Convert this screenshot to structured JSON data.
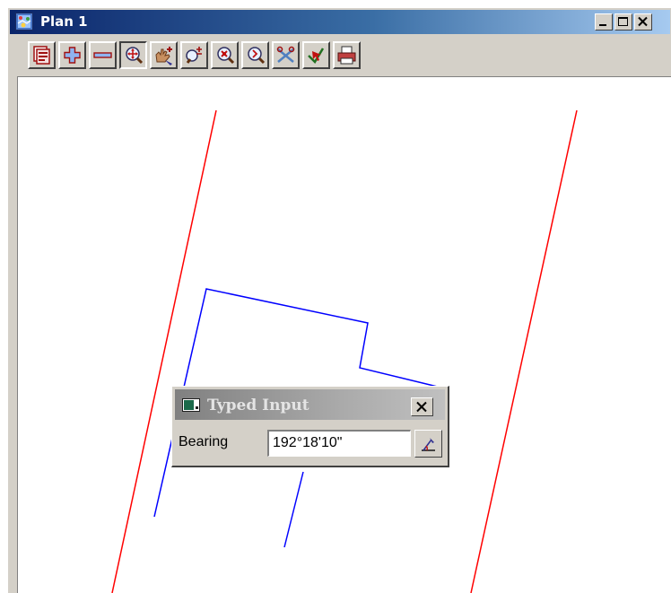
{
  "window": {
    "title": "Plan 1",
    "title_icon": "plan-view-icon",
    "caption_buttons": [
      "minimize-icon",
      "maximize-icon",
      "close-icon"
    ]
  },
  "toolbar": {
    "buttons": [
      {
        "name": "plot-views-button",
        "icon": "views-icon"
      },
      {
        "name": "zoom-in-button",
        "icon": "plus-icon"
      },
      {
        "name": "zoom-out-button",
        "icon": "minus-icon"
      },
      {
        "name": "pan-button",
        "icon": "pan-zoom-icon",
        "pressed": true
      },
      {
        "name": "add-element-button",
        "icon": "hand-plus-icon"
      },
      {
        "name": "zoom-plus-minus-button",
        "icon": "zoom-plus-minus-icon"
      },
      {
        "name": "zoom-extent-button",
        "icon": "zoom-extent-icon"
      },
      {
        "name": "zoom-window-button",
        "icon": "zoom-window-icon"
      },
      {
        "name": "clip-button",
        "icon": "scissors-icon"
      },
      {
        "name": "cursor-button",
        "icon": "check-arrow-icon"
      },
      {
        "name": "print-button",
        "icon": "printer-icon"
      }
    ]
  },
  "colors": {
    "red_lines": "#ff0000",
    "blue_lines": "#0000ff",
    "titlebar_start": "#0a246a",
    "titlebar_end": "#a6caf0"
  },
  "dialog": {
    "title": "Typed Input",
    "field_label": "Bearing",
    "field_value": "192°18'10\"",
    "pick_icon": "pick-bearing-icon",
    "close_icon": "close-icon"
  }
}
